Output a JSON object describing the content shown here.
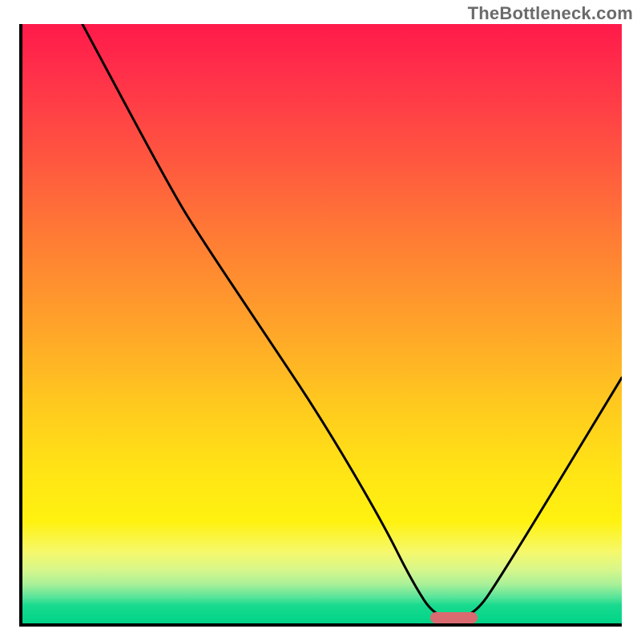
{
  "watermark": "TheBottleneck.com",
  "chart_data": {
    "type": "line",
    "title": "",
    "xlabel": "",
    "ylabel": "",
    "xlim": [
      0,
      100
    ],
    "ylim": [
      0,
      100
    ],
    "grid": false,
    "legend": false,
    "series": [
      {
        "name": "curve",
        "color": "#000000",
        "x": [
          10,
          25,
          30,
          40,
          50,
          60,
          65,
          69,
          75,
          80,
          100
        ],
        "y": [
          100,
          72,
          64,
          49,
          34,
          17,
          7,
          0.8,
          0.8,
          8,
          41
        ]
      }
    ],
    "annotations": [
      {
        "name": "bottleneck-marker",
        "type": "segment",
        "x_start": 68,
        "x_end": 76,
        "y": 0.9,
        "color": "#d96a70"
      }
    ],
    "background_gradient": {
      "direction": "vertical",
      "stops": [
        {
          "pos": 0.0,
          "color": "#ff1a4a"
        },
        {
          "pos": 0.5,
          "color": "#ffa22a"
        },
        {
          "pos": 0.83,
          "color": "#fff210"
        },
        {
          "pos": 1.0,
          "color": "#00d488"
        }
      ]
    }
  },
  "plot": {
    "inner_width": 748,
    "inner_height": 748
  }
}
